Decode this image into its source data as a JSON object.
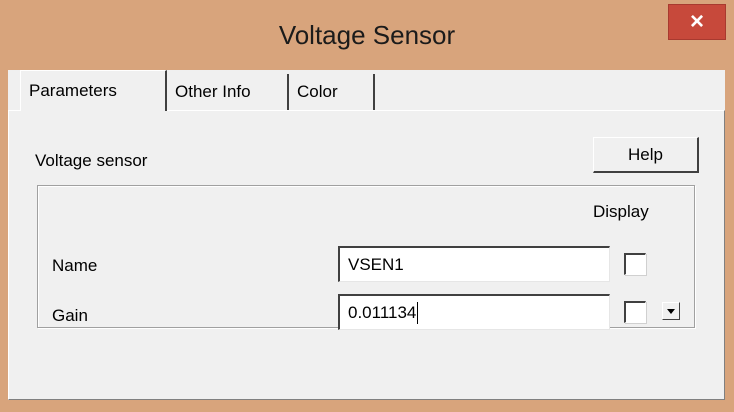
{
  "window": {
    "title": "Voltage Sensor",
    "close_label": "×"
  },
  "tabs": [
    {
      "label": "Parameters",
      "active": true
    },
    {
      "label": "Other Info",
      "active": false
    },
    {
      "label": "Color",
      "active": false
    }
  ],
  "parameters": {
    "description": "Voltage sensor",
    "help_label": "Help",
    "display_header": "Display",
    "fields": [
      {
        "label": "Name",
        "value": "VSEN1",
        "display_checked": false
      },
      {
        "label": "Gain",
        "value": "0.011134",
        "display_checked": false
      }
    ]
  },
  "colors": {
    "titlebar": "#d8a47c",
    "close_button": "#c7493b",
    "dialog_face": "#f0f0f0"
  }
}
